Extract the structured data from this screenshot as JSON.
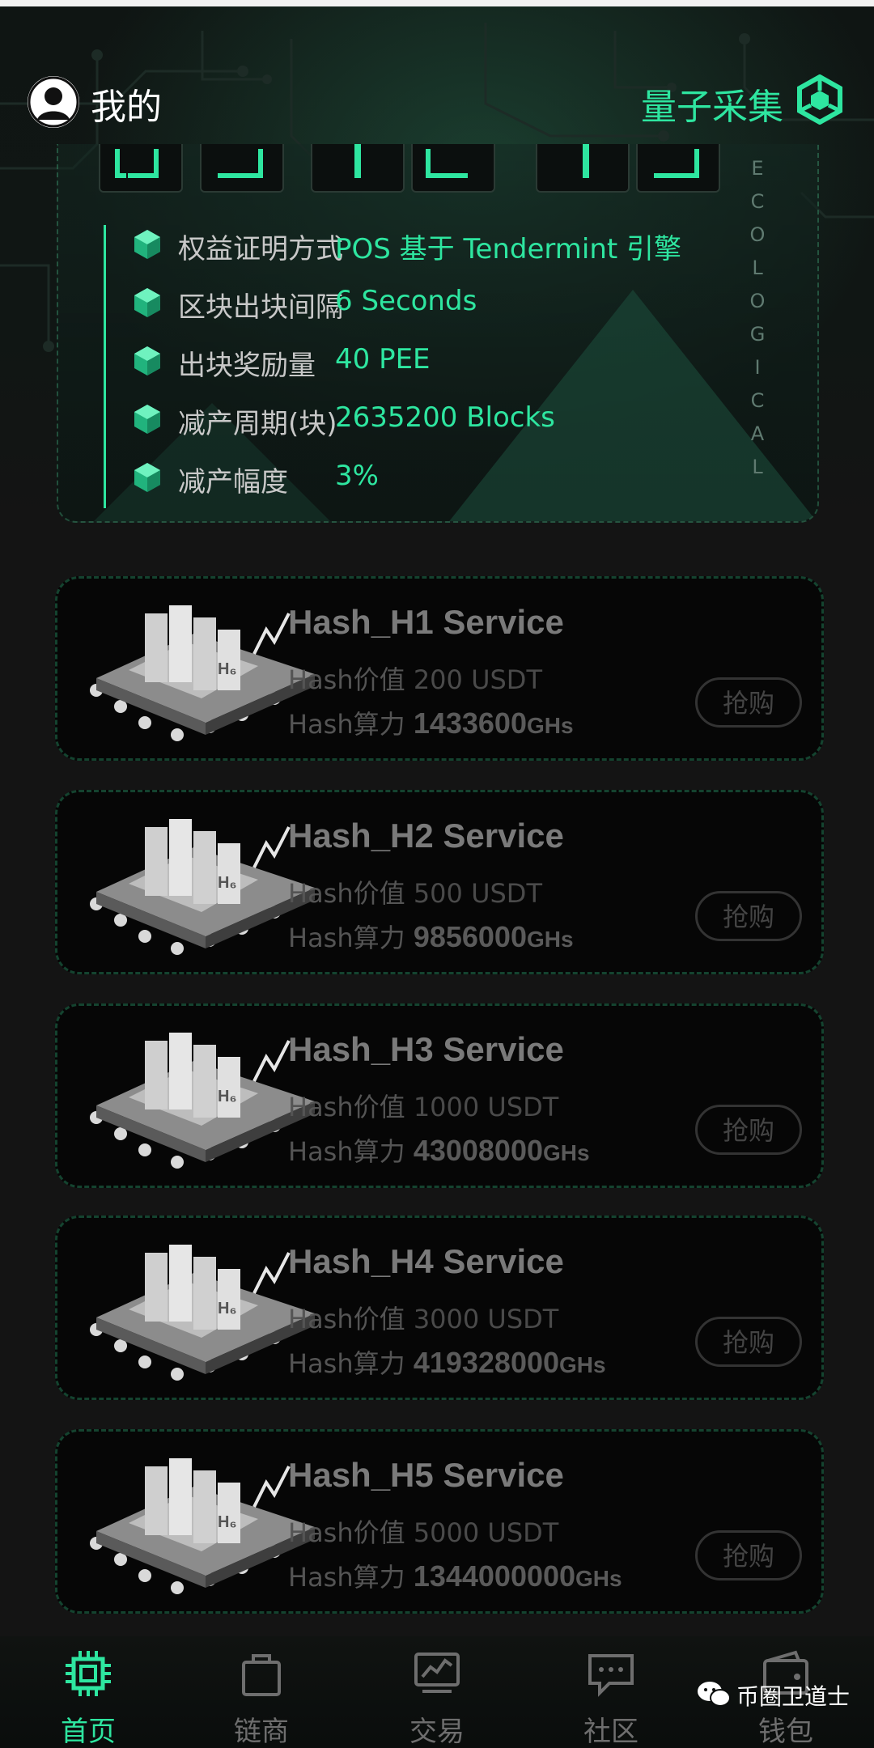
{
  "header": {
    "title_left": "我的",
    "title_right": "量子采集"
  },
  "panel": {
    "vertical_text": "ECOLOGICAL",
    "rows": [
      {
        "label": "权益证明方式",
        "value": "POS 基于 Tendermint 引擎"
      },
      {
        "label": "区块出块间隔",
        "value": "6 Seconds"
      },
      {
        "label": "出块奖励量",
        "value": "40 PEE"
      },
      {
        "label": "减产周期(块)",
        "value": "2635200 Blocks"
      },
      {
        "label": "减产幅度",
        "value": "3%"
      }
    ]
  },
  "products": [
    {
      "name": "Hash_H1 Service",
      "price_label": "Hash价值",
      "price": "200 USDT",
      "hash_label": "Hash算力",
      "hash_value": "1433600",
      "hash_unit": "GHs",
      "button": "抢购"
    },
    {
      "name": "Hash_H2 Service",
      "price_label": "Hash价值",
      "price": "500 USDT",
      "hash_label": "Hash算力",
      "hash_value": "9856000",
      "hash_unit": "GHs",
      "button": "抢购"
    },
    {
      "name": "Hash_H3 Service",
      "price_label": "Hash价值",
      "price": "1000 USDT",
      "hash_label": "Hash算力",
      "hash_value": "43008000",
      "hash_unit": "GHs",
      "button": "抢购"
    },
    {
      "name": "Hash_H4 Service",
      "price_label": "Hash价值",
      "price": "3000 USDT",
      "hash_label": "Hash算力",
      "hash_value": "419328000",
      "hash_unit": "GHs",
      "button": "抢购"
    },
    {
      "name": "Hash_H5 Service",
      "price_label": "Hash价值",
      "price": "5000 USDT",
      "hash_label": "Hash算力",
      "hash_value": "1344000000",
      "hash_unit": "GHs",
      "button": "抢购"
    }
  ],
  "nav": {
    "items": [
      {
        "label": "首页",
        "icon": "chip-icon",
        "active": true
      },
      {
        "label": "链商",
        "icon": "shopping-bag-icon",
        "active": false
      },
      {
        "label": "交易",
        "icon": "chart-icon",
        "active": false
      },
      {
        "label": "社区",
        "icon": "chat-icon",
        "active": false
      },
      {
        "label": "钱包",
        "icon": "wallet-icon",
        "active": false
      }
    ]
  },
  "watermark": "币圈卫道士",
  "colors": {
    "accent": "#2ee6a0",
    "background": "#141414",
    "card_border": "#14432f"
  }
}
